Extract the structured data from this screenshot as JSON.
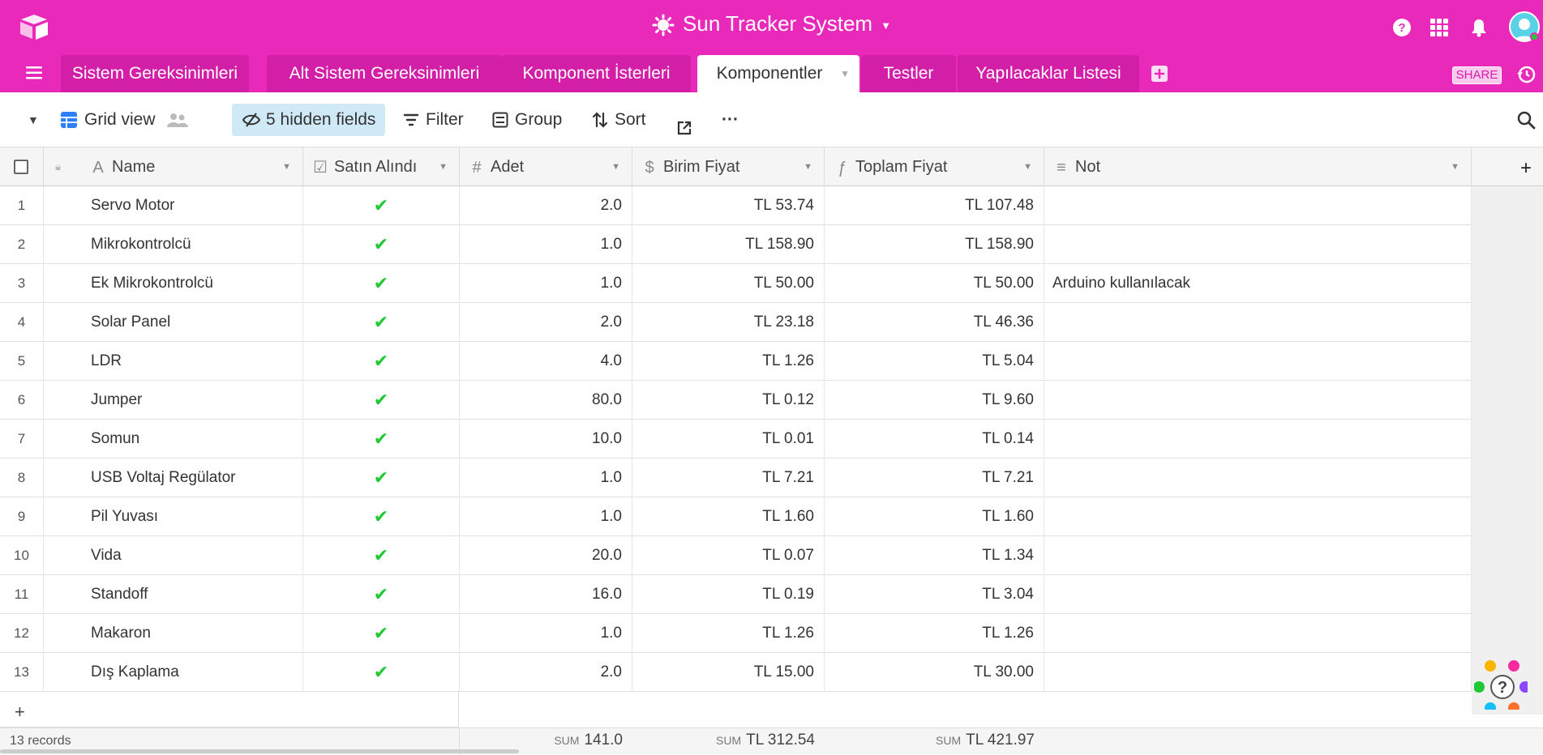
{
  "app": {
    "base_title": "Sun Tracker System",
    "brand_color": "#e929ba"
  },
  "tabs": [
    {
      "label": "Sistem Gereksinimleri"
    },
    {
      "label": "Alt Sistem Gereksinimleri"
    },
    {
      "label": "Komponent İsterleri"
    },
    {
      "label": "Komponentler",
      "active": true
    },
    {
      "label": "Testler"
    },
    {
      "label": "Yapılacaklar Listesi"
    }
  ],
  "header_actions": {
    "share_label": "SHARE"
  },
  "toolbar": {
    "view_name": "Grid view",
    "hidden_fields": "5 hidden fields",
    "filter": "Filter",
    "group": "Group",
    "sort": "Sort",
    "more": "···"
  },
  "columns": [
    {
      "label": "Name",
      "icon": "text-icon"
    },
    {
      "label": "Satın Alındı",
      "icon": "checkbox-icon"
    },
    {
      "label": "Adet",
      "icon": "number-icon"
    },
    {
      "label": "Birim Fiyat",
      "icon": "currency-icon"
    },
    {
      "label": "Toplam Fiyat",
      "icon": "formula-icon"
    },
    {
      "label": "Not",
      "icon": "long-text-icon"
    }
  ],
  "rows": [
    {
      "index": "1",
      "name": "Servo Motor",
      "adet": "2.0",
      "birim": "TL 53.74",
      "toplam": "TL 107.48",
      "not": ""
    },
    {
      "index": "2",
      "name": "Mikrokontrolcü",
      "adet": "1.0",
      "birim": "TL 158.90",
      "toplam": "TL 158.90",
      "not": ""
    },
    {
      "index": "3",
      "name": "Ek Mikrokontrolcü",
      "adet": "1.0",
      "birim": "TL 50.00",
      "toplam": "TL 50.00",
      "not": "Arduino kullanılacak"
    },
    {
      "index": "4",
      "name": "Solar Panel",
      "adet": "2.0",
      "birim": "TL 23.18",
      "toplam": "TL 46.36",
      "not": ""
    },
    {
      "index": "5",
      "name": "LDR",
      "adet": "4.0",
      "birim": "TL 1.26",
      "toplam": "TL 5.04",
      "not": ""
    },
    {
      "index": "6",
      "name": "Jumper",
      "adet": "80.0",
      "birim": "TL 0.12",
      "toplam": "TL 9.60",
      "not": ""
    },
    {
      "index": "7",
      "name": "Somun",
      "adet": "10.0",
      "birim": "TL 0.01",
      "toplam": "TL 0.14",
      "not": ""
    },
    {
      "index": "8",
      "name": "USB Voltaj Regülator",
      "adet": "1.0",
      "birim": "TL 7.21",
      "toplam": "TL 7.21",
      "not": ""
    },
    {
      "index": "9",
      "name": "Pil Yuvası",
      "adet": "1.0",
      "birim": "TL 1.60",
      "toplam": "TL 1.60",
      "not": ""
    },
    {
      "index": "10",
      "name": "Vida",
      "adet": "20.0",
      "birim": "TL 0.07",
      "toplam": "TL 1.34",
      "not": ""
    },
    {
      "index": "11",
      "name": "Standoff",
      "adet": "16.0",
      "birim": "TL 0.19",
      "toplam": "TL 3.04",
      "not": ""
    },
    {
      "index": "12",
      "name": "Makaron",
      "adet": "1.0",
      "birim": "TL 1.26",
      "toplam": "TL 1.26",
      "not": ""
    },
    {
      "index": "13",
      "name": "Dış Kaplama",
      "adet": "2.0",
      "birim": "TL 15.00",
      "toplam": "TL 30.00",
      "not": ""
    }
  ],
  "checked_mark": "✔",
  "footer": {
    "records": "13 records",
    "sum_label": "SUM",
    "sum_adet": "141.0",
    "sum_birim": "TL 312.54",
    "sum_toplam": "TL 421.97"
  }
}
